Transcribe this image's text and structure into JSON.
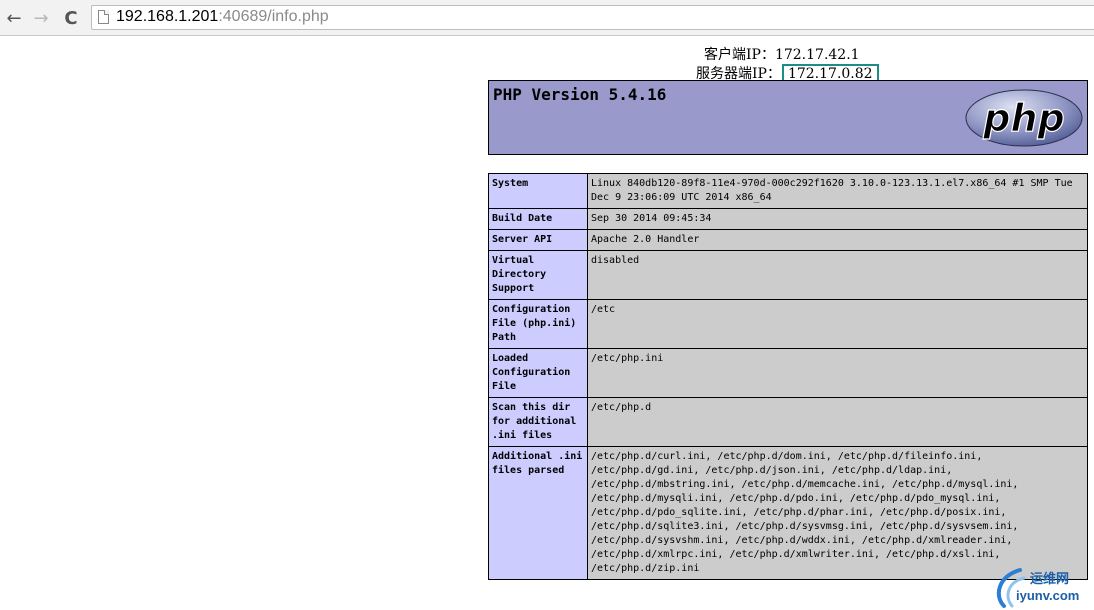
{
  "browser": {
    "url_host": "192.168.1.201",
    "url_rest": ":40689/info.php",
    "back_glyph": "←",
    "forward_glyph": "→",
    "reload_glyph": "C"
  },
  "ip_header": {
    "client_label": "客户端IP：",
    "client_ip": "172.17.42.1",
    "server_label": "服务器端IP：",
    "server_ip": "172.17.0.82",
    "highlight_color": "#1d8c87"
  },
  "banner": {
    "title": "PHP Version 5.4.16",
    "logo_text": "php",
    "background_color": "#9999cc"
  },
  "info_rows": [
    {
      "key": "System",
      "value": "Linux 840db120-89f8-11e4-970d-000c292f1620 3.10.0-123.13.1.el7.x86_64 #1 SMP Tue Dec 9 23:06:09 UTC 2014 x86_64"
    },
    {
      "key": "Build Date",
      "value": "Sep 30 2014 09:45:34"
    },
    {
      "key": "Server API",
      "value": "Apache 2.0 Handler"
    },
    {
      "key": "Virtual Directory Support",
      "value": "disabled"
    },
    {
      "key": "Configuration File (php.ini) Path",
      "value": "/etc"
    },
    {
      "key": "Loaded Configuration File",
      "value": "/etc/php.ini"
    },
    {
      "key": "Scan this dir for additional .ini files",
      "value": "/etc/php.d"
    },
    {
      "key": "Additional .ini files parsed",
      "value": "/etc/php.d/curl.ini, /etc/php.d/dom.ini, /etc/php.d/fileinfo.ini, /etc/php.d/gd.ini, /etc/php.d/json.ini, /etc/php.d/ldap.ini, /etc/php.d/mbstring.ini, /etc/php.d/memcache.ini, /etc/php.d/mysql.ini, /etc/php.d/mysqli.ini, /etc/php.d/pdo.ini, /etc/php.d/pdo_mysql.ini, /etc/php.d/pdo_sqlite.ini, /etc/php.d/phar.ini, /etc/php.d/posix.ini, /etc/php.d/sqlite3.ini, /etc/php.d/sysvmsg.ini, /etc/php.d/sysvsem.ini, /etc/php.d/sysvshm.ini, /etc/php.d/wddx.ini, /etc/php.d/xmlreader.ini, /etc/php.d/xmlrpc.ini, /etc/php.d/xmlwriter.ini, /etc/php.d/xsl.ini, /etc/php.d/zip.ini"
    }
  ],
  "watermark": {
    "cn": "运维网",
    "en": "iyunv.com"
  },
  "icons": [
    "back-arrow-icon",
    "forward-arrow-icon",
    "reload-icon",
    "page-icon",
    "php-logo-icon",
    "watermark-logo-icon"
  ]
}
